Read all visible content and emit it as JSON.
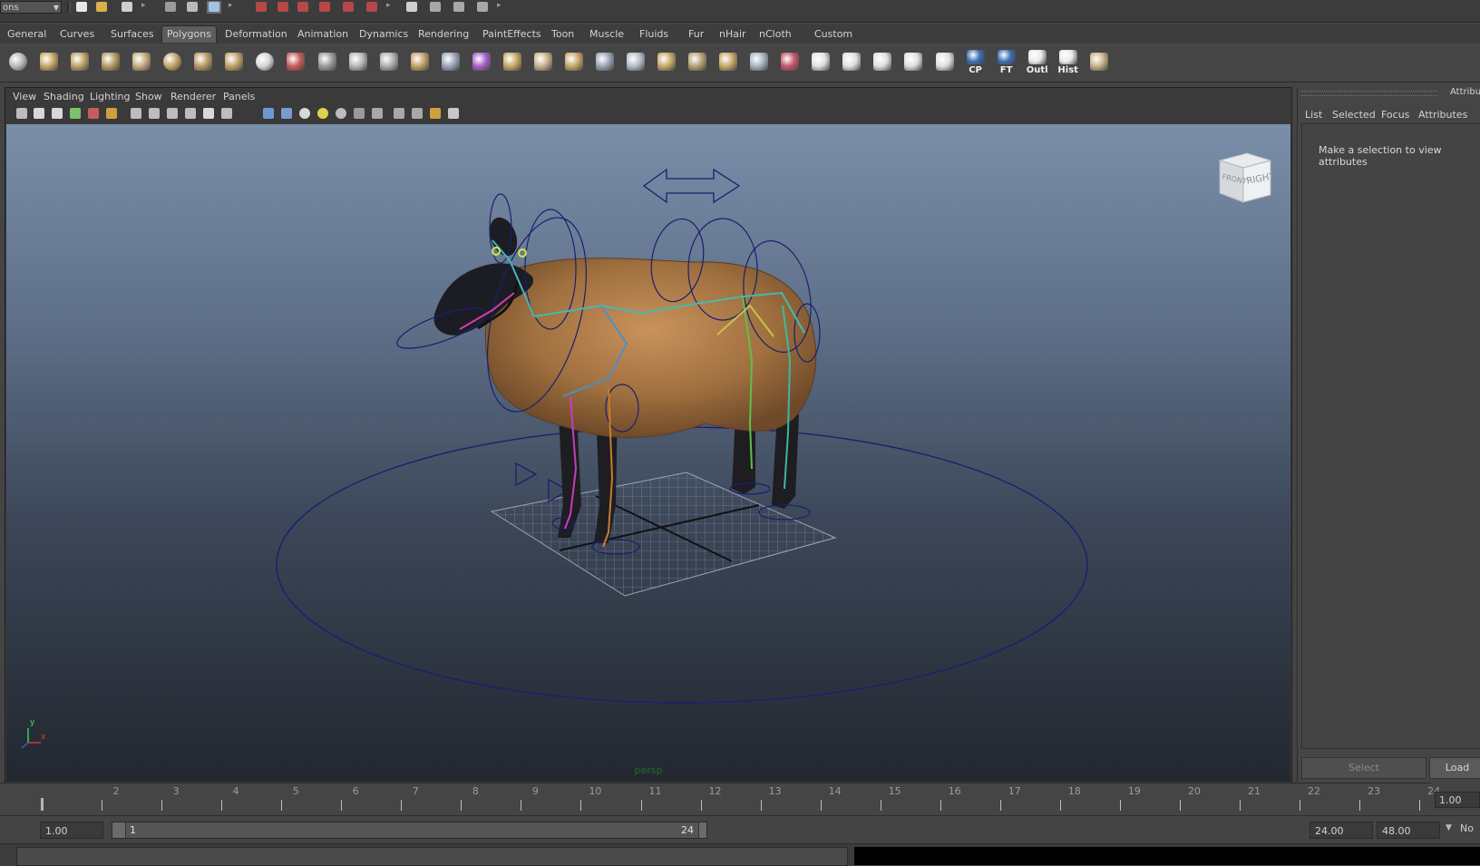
{
  "status_line": {
    "mode_menu_value": "ons",
    "icons": [
      "new-scene-icon",
      "open-scene-icon",
      "save-scene-icon",
      "select-hierarchy-icon",
      "select-object-icon",
      "select-component-icon",
      "snap-grid-icon",
      "snap-curve-icon",
      "snap-point-icon",
      "snap-plane-icon",
      "make-live-icon",
      "history-icon",
      "render-icon",
      "ipr-render-icon",
      "render-settings-icon",
      "hypershade-icon"
    ]
  },
  "shelf_tabs": [
    "General",
    "Curves",
    "Surfaces",
    "Polygons",
    "Deformation",
    "Animation",
    "Dynamics",
    "Rendering",
    "PaintEffects",
    "Toon",
    "Muscle",
    "Fluids",
    "Fur",
    "nHair",
    "nCloth",
    "Custom"
  ],
  "active_shelf_tab": "Polygons",
  "shelf_buttons": [
    {
      "name": "poly-sphere",
      "label": ""
    },
    {
      "name": "poly-cube",
      "label": ""
    },
    {
      "name": "poly-cylinder",
      "label": ""
    },
    {
      "name": "poly-cone",
      "label": ""
    },
    {
      "name": "poly-plane",
      "label": ""
    },
    {
      "name": "poly-torus",
      "label": ""
    },
    {
      "name": "poly-pyramid",
      "label": ""
    },
    {
      "name": "poly-pipe",
      "label": ""
    },
    {
      "name": "poly-soccer-ball",
      "label": ""
    },
    {
      "name": "combine",
      "label": ""
    },
    {
      "name": "separate",
      "label": ""
    },
    {
      "name": "extract",
      "label": ""
    },
    {
      "name": "smooth",
      "label": ""
    },
    {
      "name": "split-polygon",
      "label": ""
    },
    {
      "name": "insert-edge-loop",
      "label": ""
    },
    {
      "name": "extrude",
      "label": ""
    },
    {
      "name": "bridge",
      "label": ""
    },
    {
      "name": "append-polygon",
      "label": ""
    },
    {
      "name": "merge-vertex",
      "label": ""
    },
    {
      "name": "fill-hole",
      "label": ""
    },
    {
      "name": "bevel",
      "label": ""
    },
    {
      "name": "wedge",
      "label": ""
    },
    {
      "name": "cut-faces",
      "label": ""
    },
    {
      "name": "collapse",
      "label": ""
    },
    {
      "name": "poke",
      "label": ""
    },
    {
      "name": "sculpt",
      "label": ""
    },
    {
      "name": "planar-mapping",
      "label": ""
    },
    {
      "name": "automatic-mapping",
      "label": ""
    },
    {
      "name": "cylindrical-mapping",
      "label": ""
    },
    {
      "name": "uv-editor",
      "label": ""
    },
    {
      "name": "checker-map",
      "label": ""
    },
    {
      "name": "center-pivot",
      "label": "CP"
    },
    {
      "name": "freeze-transform",
      "label": "FT"
    },
    {
      "name": "outliner",
      "label": "Outl"
    },
    {
      "name": "delete-history",
      "label": "Hist"
    },
    {
      "name": "layer-editor",
      "label": ""
    }
  ],
  "panel_menu": [
    "View",
    "Shading",
    "Lighting",
    "Show",
    "Renderer",
    "Panels"
  ],
  "panel_toolbar_icons": [
    "select-camera-icon",
    "camera-attributes-icon",
    "bookmark-icon",
    "image-plane-icon",
    "grid-toggle-icon",
    "film-gate-icon",
    "resolution-gate-icon",
    "safe-action-icon",
    "safe-title-icon",
    "field-chart-icon",
    "wireframe-icon",
    "smooth-shade-icon",
    "wireframe-on-shaded-icon",
    "textured-icon",
    "use-all-lights-icon",
    "shadows-icon",
    "high-quality-icon",
    "isolate-select-icon",
    "xray-icon",
    "xray-joints-icon",
    "single-panel-icon",
    "four-panel-icon",
    "outliner-panel-icon"
  ],
  "viewport": {
    "camera_label": "persp",
    "viewcube": {
      "left_face": "FRONT",
      "right_face": "RIGHT"
    },
    "axis_y": "y",
    "axis_x": "x"
  },
  "attribute_editor": {
    "title": "Attribute",
    "tabs": [
      "List",
      "Selected",
      "Focus",
      "Attributes"
    ],
    "message": "Make a selection to view attributes",
    "select_button": "Select",
    "load_button": "Load"
  },
  "time_slider": {
    "ticks": [
      "2",
      "3",
      "4",
      "5",
      "6",
      "7",
      "8",
      "9",
      "10",
      "11",
      "12",
      "13",
      "14",
      "15",
      "16",
      "17",
      "18",
      "19",
      "20",
      "21",
      "22",
      "23",
      "24"
    ],
    "current_frame": "1.00"
  },
  "range_slider": {
    "start_time": "1.00",
    "range_start_label": "1",
    "range_end_label": "24",
    "end_time": "24.00",
    "anim_end": "48.00",
    "char_set": "No"
  },
  "colors": {
    "maya_ui": "#444444",
    "viewport_top": "#7a8ea9",
    "viewport_bottom": "#22272f",
    "rig_curve": "#1b1f6e",
    "sheep_wool": "#a8774a",
    "sheep_face": "#1c1c24"
  }
}
